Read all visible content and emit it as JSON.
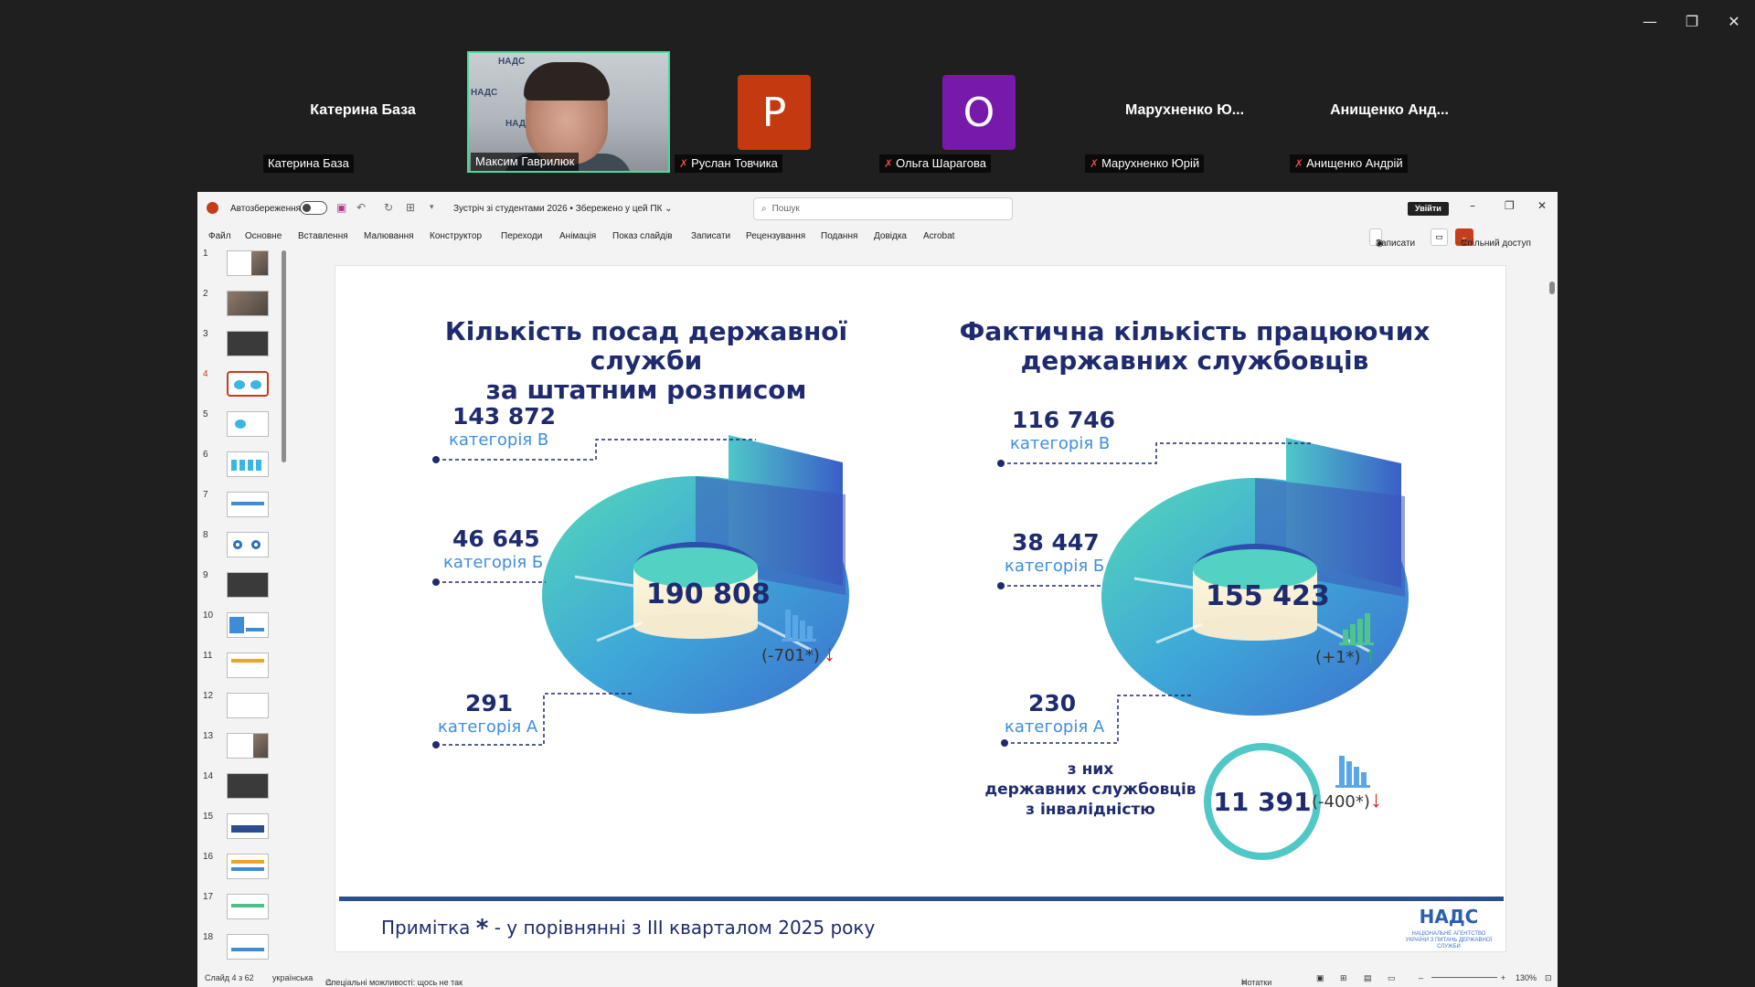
{
  "participants": [
    {
      "name": "Катерина База",
      "label": "Катерина База"
    },
    {
      "name": "Максим Гаврилюк",
      "label": "Максим Гаврилюк",
      "wall": "НАДС"
    },
    {
      "initial": "P",
      "label": "Руслан Товчика",
      "color": "#c4390f"
    },
    {
      "initial": "O",
      "label": "Ольга Шарагова",
      "color": "#7719aa"
    },
    {
      "name": "Марухненко Ю...",
      "label": "Марухненко Юрій"
    },
    {
      "name": "Анищенко Анд...",
      "label": "Анищенко Андрій"
    }
  ],
  "window_controls": {
    "minimize": "—",
    "restore": "❐",
    "close": "✕"
  },
  "ppt": {
    "autosave": "Автозбереження",
    "doc_title": "Зустріч зі студентами 2026 • Збережено у цей ПК ⌄",
    "search_placeholder": "Пошук",
    "signin": "Увійти",
    "menu": [
      "Файл",
      "Основне",
      "Вставлення",
      "Малювання",
      "Конструктор",
      "Переходи",
      "Анімація",
      "Показ слайдів",
      "Записати",
      "Рецензування",
      "Подання",
      "Довідка",
      "Acrobat"
    ],
    "record": "Записати",
    "share": "Спільний доступ",
    "thumb_numbers": [
      "1",
      "2",
      "3",
      "4",
      "5",
      "6",
      "7",
      "8",
      "9",
      "10",
      "11",
      "12",
      "13",
      "14",
      "15",
      "16",
      "17",
      "18"
    ],
    "status_slide": "Слайд 4 з 62",
    "status_lang": "українська",
    "status_access": "Спеціальні можливості: щось не так",
    "status_notes": "Нотатки",
    "status_zoom": "130%"
  },
  "slide": {
    "left_title_1": "Кількість посад державної служби",
    "left_title_2": "за штатним розписом",
    "right_title_1": "Фактична кількість працюючих",
    "right_title_2": "державних службовців",
    "left": {
      "cat_b_num": "143 872",
      "cat_b": "категорія В",
      "cat_b2_num": "46 645",
      "cat_b2": "категорія Б",
      "cat_a_num": "291",
      "cat_a": "категорія А",
      "total": "190 808",
      "delta": "(-701*)"
    },
    "right": {
      "cat_b_num": "116 746",
      "cat_b": "категорія В",
      "cat_b2_num": "38 447",
      "cat_b2": "категорія Б",
      "cat_a_num": "230",
      "cat_a": "категорія А",
      "total": "155 423",
      "delta": "(+1*)",
      "disabled_1": "з них",
      "disabled_2": "державних службовців",
      "disabled_3": "з інвалідністю",
      "disabled_num": "11 391",
      "disabled_delta": "(-400*)"
    },
    "footnote_prefix": "Примітка",
    "footnote_star": "*",
    "footnote_text": "- у порівнянні з ІІІ кварталом 2025 року",
    "logo": "НАДС",
    "logo_sub": "НАЦІОНАЛЬНЕ АГЕНТСТВО УКРАЇНИ З ПИТАНЬ ДЕРЖАВНОЇ СЛУЖБИ"
  }
}
